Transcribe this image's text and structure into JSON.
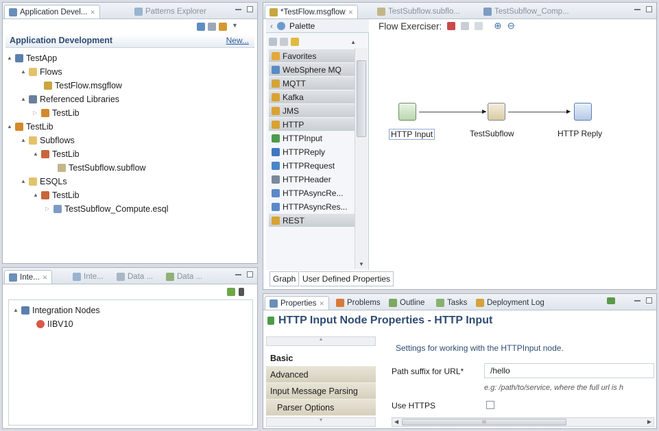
{
  "left_top_panel": {
    "tabs": [
      "Application Devel...",
      "Patterns Explorer"
    ],
    "header_title": "Application Development",
    "new_link": "New...",
    "tree": [
      {
        "label": "TestApp",
        "icon": "app-icon"
      },
      {
        "label": "Flows",
        "icon": "folder-icon"
      },
      {
        "label": "TestFlow.msgflow",
        "icon": "msgflow-icon"
      },
      {
        "label": "Referenced Libraries",
        "icon": "library-icon"
      },
      {
        "label": "TestLib",
        "icon": "lib-icon"
      },
      {
        "label": "TestLib",
        "icon": "lib-icon"
      },
      {
        "label": "Subflows",
        "icon": "folder-icon"
      },
      {
        "label": "TestLib",
        "icon": "package-icon"
      },
      {
        "label": "TestSubflow.subflow",
        "icon": "subflow-icon"
      },
      {
        "label": "ESQLs",
        "icon": "folder-icon"
      },
      {
        "label": "TestLib",
        "icon": "package-icon"
      },
      {
        "label": "TestSubflow_Compute.esql",
        "icon": "esql-icon"
      }
    ]
  },
  "left_bottom_panel": {
    "tabs": [
      "Inte...",
      "Inte...",
      "Data ...",
      "Data ..."
    ],
    "tree": [
      {
        "label": "Integration Nodes",
        "icon": "nodes-icon"
      },
      {
        "label": "IIBV10",
        "icon": "node-icon"
      }
    ]
  },
  "editor": {
    "tabs": [
      "*TestFlow.msgflow",
      "TestSubflow.subflo...",
      "TestSubflow_Comp..."
    ],
    "palette_label": "Palette",
    "flow_exerciser_label": "Flow Exerciser:",
    "palette_items": [
      {
        "label": "Favorites",
        "drawer": true,
        "color": "#e2a93b"
      },
      {
        "label": "WebSphere MQ",
        "drawer": true,
        "color": "#5a8ac6"
      },
      {
        "label": "MQTT",
        "drawer": true,
        "color": "#d4a43a"
      },
      {
        "label": "Kafka",
        "drawer": true,
        "color": "#d9a231"
      },
      {
        "label": "JMS",
        "drawer": true,
        "color": "#d9a231"
      },
      {
        "label": "HTTP",
        "drawer": true,
        "color": "#d9a231"
      },
      {
        "label": "HTTPInput",
        "drawer": false,
        "color": "#4d9a4a"
      },
      {
        "label": "HTTPReply",
        "drawer": false,
        "color": "#3f78c0"
      },
      {
        "label": "HTTPRequest",
        "drawer": false,
        "color": "#4b86c9"
      },
      {
        "label": "HTTPHeader",
        "drawer": false,
        "color": "#7a8a9a"
      },
      {
        "label": "HTTPAsyncRe...",
        "drawer": false,
        "color": "#5a8ac6"
      },
      {
        "label": "HTTPAsyncRes...",
        "drawer": false,
        "color": "#5a8ac6"
      },
      {
        "label": "REST",
        "drawer": true,
        "color": "#d9a231"
      }
    ],
    "nodes": [
      "HTTP Input",
      "TestSubflow",
      "HTTP Reply"
    ],
    "bottom_tabs": [
      "Graph",
      "User Defined Properties"
    ]
  },
  "properties": {
    "tabs": [
      "Properties",
      "Problems",
      "Outline",
      "Tasks",
      "Deployment Log"
    ],
    "title": "HTTP Input Node Properties - HTTP Input",
    "nav": [
      "Basic",
      "Advanced",
      "Input Message Parsing",
      "Parser Options"
    ],
    "description": "Settings for working with the HTTPInput node.",
    "path_label": "Path suffix for URL*",
    "path_value": "/hello",
    "path_hint": "e.g: /path/to/service, where the full url is h",
    "https_label": "Use HTTPS",
    "scroll_mark": "III"
  }
}
